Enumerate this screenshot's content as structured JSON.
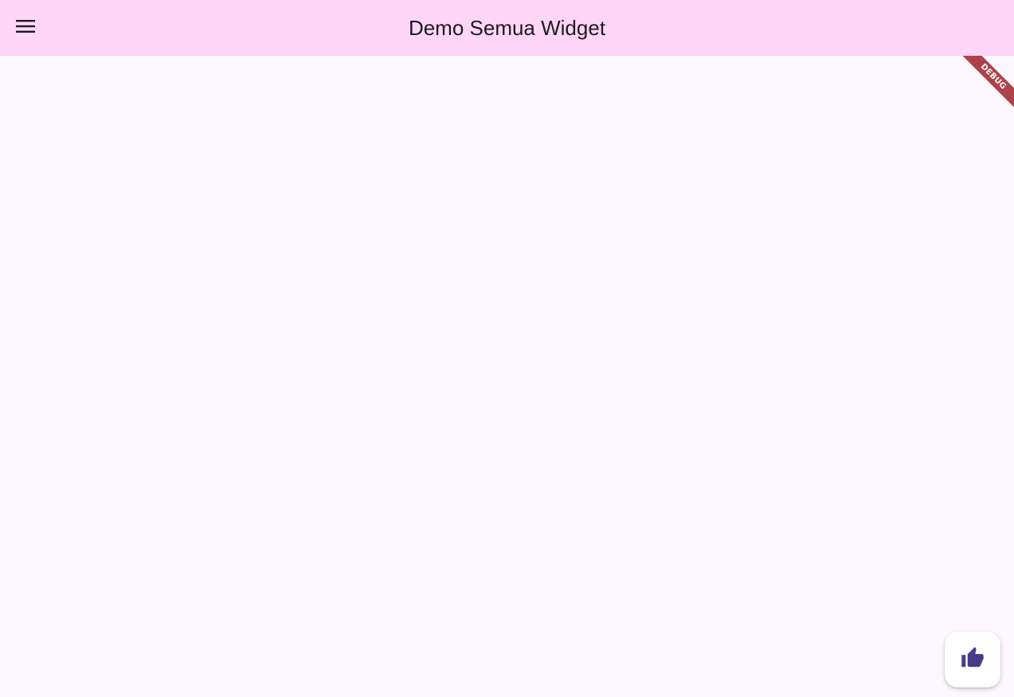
{
  "app_bar": {
    "title": "Demo Semua Widget",
    "background_color": "#ffd6f7",
    "menu_icon": "menu-icon"
  },
  "page": {
    "background_color": "#fdf7ff"
  },
  "debug_banner": {
    "label": "DEBUG",
    "color": "#a0232b"
  },
  "fab": {
    "icon": "thumb-up-icon",
    "icon_color": "#4a3a8a",
    "background_color": "#ffffff"
  }
}
